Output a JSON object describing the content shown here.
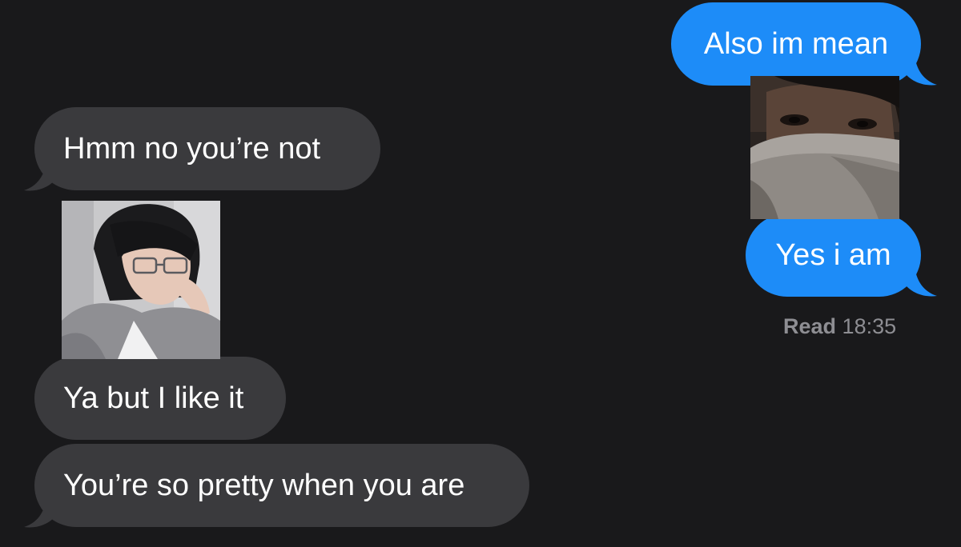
{
  "conversation": {
    "sent": [
      {
        "text": "Also im mean"
      },
      {
        "text": "Yes i am"
      }
    ],
    "received": [
      {
        "text": "Hmm no you’re not"
      },
      {
        "text": "Ya but I like it"
      },
      {
        "text": "You’re so pretty when you are"
      }
    ],
    "read_receipt": {
      "label": "Read",
      "time": "18:35"
    }
  },
  "colors": {
    "background": "#19191b",
    "sent_bubble": "#1d8cf8",
    "received_bubble": "#3a3a3d",
    "receipt_text": "#8e8e93"
  }
}
